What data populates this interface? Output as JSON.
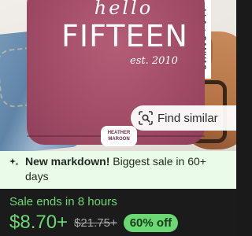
{
  "product_image": {
    "shirt_text_line1": "hello",
    "shirt_text_line2": "FIFTEEN",
    "shirt_text_line3": "est. 2010",
    "tag_line1": "HEATHER",
    "tag_line2": "MAROON",
    "side_label": "LLA + CANVAS",
    "shirt_color": "#a24d68"
  },
  "find_similar": {
    "icon": "scan-search-icon",
    "label": "Find similar"
  },
  "markdown_banner": {
    "icon": "sparkle-icon",
    "title": "New markdown!",
    "text": "Biggest sale in 60+ days",
    "background": "#eafbe9"
  },
  "sale": {
    "ends_text": "Sale ends in 8 hours",
    "price": "$8.70+",
    "original_price": "$21.75+",
    "discount": "60% off",
    "accent": "#6cd874"
  }
}
